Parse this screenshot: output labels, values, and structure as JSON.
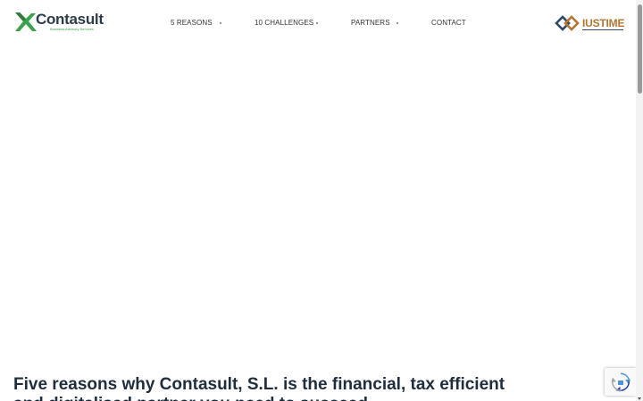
{
  "header": {
    "logo": {
      "name": "Contasult",
      "tagline": "Business Advisory Services"
    },
    "nav": [
      {
        "label": "5 REASONS"
      },
      {
        "label": "10 CHALLENGES"
      },
      {
        "label": "PARTNERS"
      },
      {
        "label": "CONTACT"
      }
    ],
    "partner_logo": {
      "name": "IUSTIME"
    }
  },
  "main": {
    "headline": "Five reasons why Contasult, S.L. is the financial, tax efficient and digitalised partner you need to succeed"
  },
  "colors": {
    "brand_green": "#3aa24a",
    "brand_dark": "#2e3b4a",
    "partner_orange": "#b8742f",
    "partner_navy": "#2e4a66",
    "headline_text": "#1f2d3d"
  },
  "icons": {
    "recaptcha": "recaptcha-icon",
    "logo_mark": "contasult-x-icon",
    "partner_mark": "iustime-diamond-icon"
  }
}
